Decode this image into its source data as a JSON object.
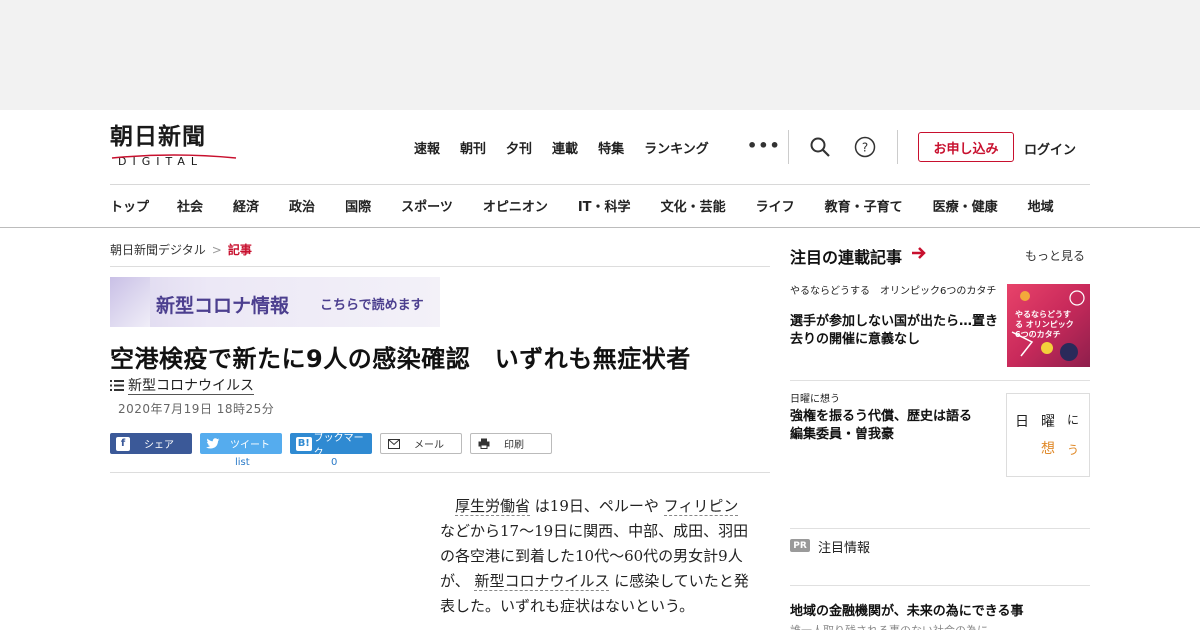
{
  "site": {
    "logo_jp": "朝日新聞",
    "logo_en": "DIGITAL"
  },
  "topnav": [
    "速報",
    "朝刊",
    "夕刊",
    "連載",
    "特集",
    "ランキング"
  ],
  "header": {
    "more_icon": "more-dots-icon",
    "search_icon": "search-icon",
    "help_icon": "help-icon",
    "subscribe_label": "お申し込み",
    "login_label": "ログイン",
    "accent_color": "#c8102e"
  },
  "catnav": [
    "トップ",
    "社会",
    "経済",
    "政治",
    "国際",
    "スポーツ",
    "オピニオン",
    "IT・科学",
    "文化・芸能",
    "ライフ",
    "教育・子育て",
    "医療・健康",
    "地域"
  ],
  "breadcrumb": {
    "home": "朝日新聞デジタル",
    "separator": ">",
    "current": "記事"
  },
  "banner": {
    "title": "新型コロナ情報",
    "link": "こちらで読めます"
  },
  "article": {
    "headline": "空港検疫で新たに9人の感染確認　いずれも無症状者",
    "topic": "新型コロナウイルス",
    "date": "2020年7月19日 18時25分",
    "body": {
      "kw1": "厚生労働省",
      "t1": " は19日、ペルーや ",
      "kw2": "フィリピン",
      "t2": " などから17～19日に関西、中部、成田、羽田の各空港に到着した10代～60代の男女計9人が、 ",
      "kw3": "新型コロナウイルス",
      "t3": " に感染していたと発表した。いずれも症状はないとい",
      "t4": "う。"
    }
  },
  "share": {
    "facebook": "シェア",
    "twitter": "ツイート",
    "hatena": "ブックマーク",
    "hatena_icon": "B!",
    "mail": "メール",
    "print": "印刷",
    "twitter_count": "list",
    "hatena_count": "0",
    "facebook_color": "#3b5998",
    "twitter_color": "#55acee",
    "hatena_color": "#2f8ad2"
  },
  "sidebar": {
    "heading": "注目の連載記事",
    "more": "もっと見る",
    "items": [
      {
        "category": "やるならどうする　オリンピック6つのカタチ",
        "title": "選手が参加しない国が出たら…置き去りの開催に意義なし",
        "thumb_text": "やるならどうする オリンピック 6つのカタチ"
      },
      {
        "category": "日曜に想う",
        "title": "強権を振るう代償、歴史は語る　編集委員・曽我豪",
        "thumb_chars": [
          "日",
          "曜",
          "に",
          "想",
          "う"
        ]
      }
    ],
    "pr_badge": "PR",
    "pr_label": "注目情報",
    "pr_title": "地域の金融機関が、未来の為にできる事",
    "pr_sub": "誰一人取り残される事のない社会の為に"
  }
}
